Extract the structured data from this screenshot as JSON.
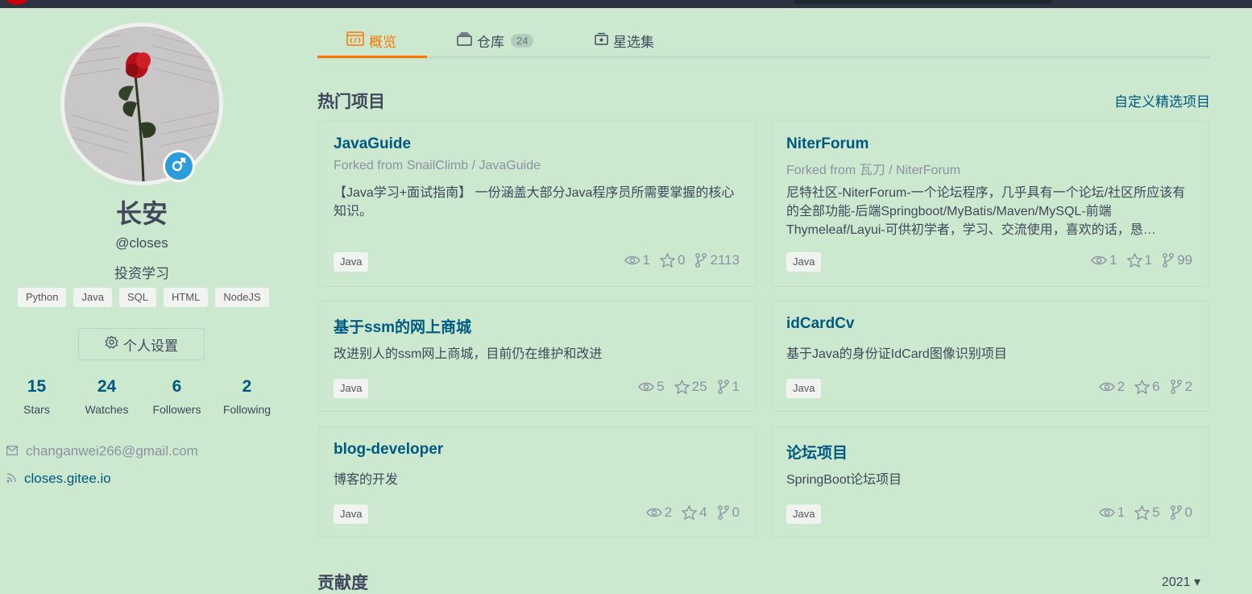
{
  "profile": {
    "name": "长安",
    "handle": "@closes",
    "bio": "投资学习",
    "tags": [
      "Python",
      "Java",
      "SQL",
      "HTML",
      "NodeJS"
    ],
    "settings_label": "个人设置",
    "stats": [
      {
        "num": "15",
        "label": "Stars"
      },
      {
        "num": "24",
        "label": "Watches"
      },
      {
        "num": "6",
        "label": "Followers"
      },
      {
        "num": "2",
        "label": "Following"
      }
    ],
    "email": "changanwei266@gmail.com",
    "website": "closes.gitee.io"
  },
  "tabs": {
    "overview": "概览",
    "repos": "仓库",
    "repos_count": "24",
    "stars": "星选集"
  },
  "section": {
    "title": "热门项目",
    "customize": "自定义精选项目"
  },
  "projects": [
    {
      "title": "JavaGuide",
      "fork": "Forked from SnailClimb  / JavaGuide",
      "desc": "【Java学习+面试指南】 一份涵盖大部分Java程序员所需要掌握的核心知识。",
      "lang": "Java",
      "watches": "1",
      "stars": "0",
      "forks": "2113"
    },
    {
      "title": "NiterForum",
      "fork": "Forked from 瓦刀  / NiterForum",
      "desc": "尼特社区-NiterForum-一个论坛程序，几乎具有一个论坛/社区所应该有的全部功能-后端Springboot/MyBatis/Maven/MySQL-前端Thymeleaf/Layui-可供初学者，学习、交流使用，喜欢的话，恳…",
      "lang": "Java",
      "watches": "1",
      "stars": "1",
      "forks": "99"
    },
    {
      "title": "基于ssm的网上商城",
      "fork": "",
      "desc": "改进别人的ssm网上商城，目前仍在维护和改进",
      "lang": "Java",
      "watches": "5",
      "stars": "25",
      "forks": "1"
    },
    {
      "title": "idCardCv",
      "fork": "",
      "desc": "基于Java的身份证IdCard图像识别项目",
      "lang": "Java",
      "watches": "2",
      "stars": "6",
      "forks": "2"
    },
    {
      "title": "blog-developer",
      "fork": "",
      "desc": "博客的开发",
      "lang": "Java",
      "watches": "2",
      "stars": "4",
      "forks": "0"
    },
    {
      "title": "论坛项目",
      "fork": "",
      "desc": "SpringBoot论坛项目",
      "lang": "Java",
      "watches": "1",
      "stars": "5",
      "forks": "0"
    }
  ],
  "contrib": {
    "title": "贡献度",
    "year": "2021 ▾"
  },
  "colors": {
    "background": "#cce8cf",
    "accent": "#fe7300",
    "link": "#005980",
    "gender_badge": "#2d9cdb"
  },
  "icons": {
    "overview_tab": "code-window-icon",
    "repos_tab": "repository-icon",
    "stars_tab": "star-collection-icon",
    "settings": "gear-icon",
    "email": "mail-icon",
    "website": "rss-icon",
    "gender": "male-icon",
    "watch": "eye-icon",
    "star": "star-icon",
    "fork": "fork-icon"
  }
}
